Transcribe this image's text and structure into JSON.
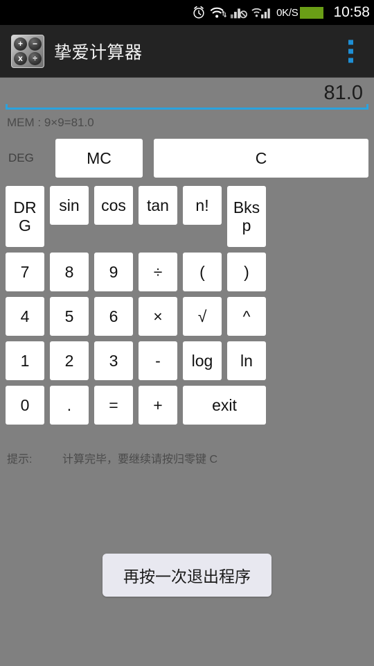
{
  "status_bar": {
    "icons": [
      "alarm-clock-icon",
      "wifi-transfer-icon",
      "signal-no-sim-icon",
      "signal-bars-icon"
    ],
    "net_speed": "0K/S",
    "battery_color": "#6a9e16",
    "clock": "10:58"
  },
  "action_bar": {
    "app_icon_keys": [
      "+",
      "−",
      "x",
      "÷"
    ],
    "title": "挚爱计算器",
    "overflow_label": "more-options",
    "accent_color": "#1e8fd5",
    "background_color": "#232323"
  },
  "display": {
    "value": "81.0",
    "underline_color": "#2aa3df"
  },
  "memory": {
    "text": "MEM : 9×9=81.0"
  },
  "mode": {
    "deg_label": "DEG"
  },
  "top_buttons": {
    "mc_label": "MC",
    "c_label": "C"
  },
  "keypad": {
    "rows": [
      [
        {
          "label": "DRG",
          "lines": [
            "DR",
            "G"
          ],
          "style": "two-line"
        },
        {
          "label": "sin",
          "lines": [
            "sin"
          ],
          "style": "normal"
        },
        {
          "label": "cos",
          "lines": [
            "cos"
          ],
          "style": "normal"
        },
        {
          "label": "tan",
          "lines": [
            "tan"
          ],
          "style": "normal"
        },
        {
          "label": "n!",
          "lines": [
            "n!"
          ],
          "style": "normal"
        },
        {
          "label": "Bksp",
          "lines": [
            "Bks",
            "p"
          ],
          "style": "two-line"
        }
      ],
      [
        {
          "label": "7",
          "lines": [
            "7"
          ],
          "style": "normal"
        },
        {
          "label": "8",
          "lines": [
            "8"
          ],
          "style": "normal"
        },
        {
          "label": "9",
          "lines": [
            "9"
          ],
          "style": "normal"
        },
        {
          "label": "÷",
          "lines": [
            "÷"
          ],
          "style": "normal"
        },
        {
          "label": "(",
          "lines": [
            "("
          ],
          "style": "normal"
        },
        {
          "label": ")",
          "lines": [
            ")"
          ],
          "style": "normal"
        }
      ],
      [
        {
          "label": "4",
          "lines": [
            "4"
          ],
          "style": "normal"
        },
        {
          "label": "5",
          "lines": [
            "5"
          ],
          "style": "normal"
        },
        {
          "label": "6",
          "lines": [
            "6"
          ],
          "style": "normal"
        },
        {
          "label": "×",
          "lines": [
            "×"
          ],
          "style": "normal"
        },
        {
          "label": "√",
          "lines": [
            "√"
          ],
          "style": "normal"
        },
        {
          "label": "^",
          "lines": [
            "^"
          ],
          "style": "normal"
        }
      ],
      [
        {
          "label": "1",
          "lines": [
            "1"
          ],
          "style": "normal"
        },
        {
          "label": "2",
          "lines": [
            "2"
          ],
          "style": "normal"
        },
        {
          "label": "3",
          "lines": [
            "3"
          ],
          "style": "normal"
        },
        {
          "label": "-",
          "lines": [
            "-"
          ],
          "style": "normal"
        },
        {
          "label": "log",
          "lines": [
            "log"
          ],
          "style": "normal"
        },
        {
          "label": "ln",
          "lines": [
            "ln"
          ],
          "style": "normal"
        }
      ],
      [
        {
          "label": "0",
          "lines": [
            "0"
          ],
          "style": "normal"
        },
        {
          "label": ".",
          "lines": [
            "."
          ],
          "style": "normal"
        },
        {
          "label": "=",
          "lines": [
            "="
          ],
          "style": "normal"
        },
        {
          "label": "+",
          "lines": [
            "+"
          ],
          "style": "normal"
        },
        {
          "label": "exit",
          "lines": [
            "exit"
          ],
          "style": "wide2"
        }
      ]
    ]
  },
  "hint": {
    "label": "提示:",
    "text": "计算完毕，要继续请按归零键 C"
  },
  "toast": {
    "message": "再按一次退出程序"
  },
  "theme": {
    "background": "#808080",
    "button_background": "#ffffff",
    "text_color": "#111111"
  }
}
